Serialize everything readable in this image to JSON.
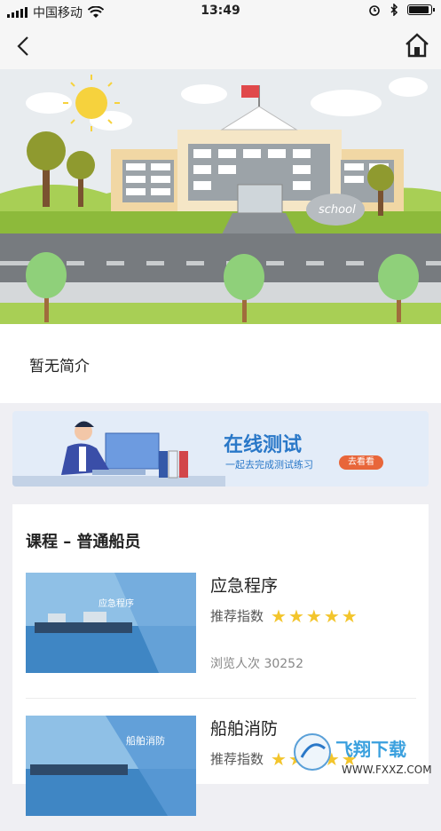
{
  "status_bar": {
    "carrier": "中国移动",
    "time": "13:49"
  },
  "hero": {
    "school_sign": "school"
  },
  "intro": {
    "text": "暂无简介"
  },
  "banner": {
    "title": "在线测试",
    "subtitle": "一起去完成测试练习",
    "button": "去看看"
  },
  "course": {
    "heading": "课程 – 普通船员",
    "items": [
      {
        "name": "应急程序",
        "thumb_caption": "应急程序",
        "rec_label": "推荐指数",
        "stars": 5,
        "views": "浏览人次 30252"
      },
      {
        "name": "船舶消防",
        "thumb_caption": "船舶消防",
        "rec_label": "推荐指数",
        "stars": 5
      }
    ]
  },
  "watermark": {
    "brand": "飞翔下载",
    "url": "WWW.FXXZ.COM"
  },
  "colors": {
    "accent": "#2a78c8",
    "button": "#e8663a",
    "star": "#f3c52c",
    "grass": "#a8cf55"
  }
}
